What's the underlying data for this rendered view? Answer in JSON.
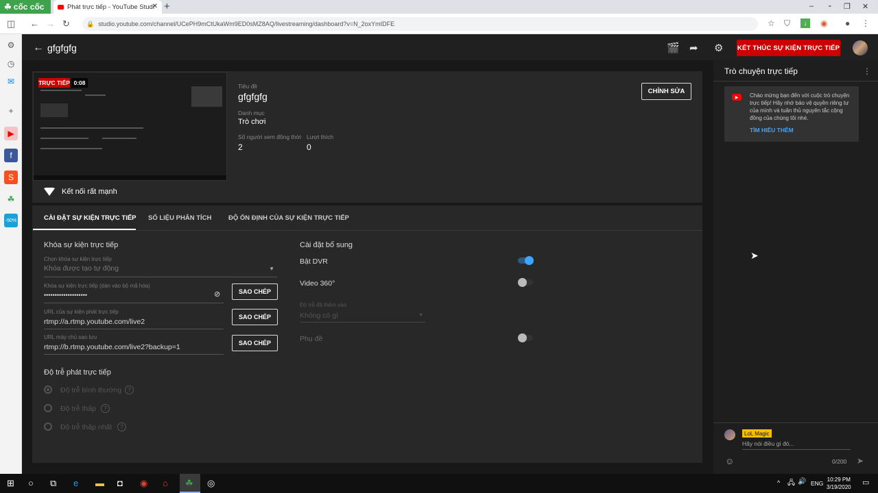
{
  "browser": {
    "brand": "cốc cốc",
    "tab_title": "Phát trực tiếp - YouTube Studi",
    "url": "studio.youtube.com/channel/UCePH9mCtUkaWm9ED0sMZ8AQ/livestreaming/dashboard?v=N_2oxYmIDFE"
  },
  "header": {
    "title": "gfgfgfg",
    "end_button": "KẾT THÚC SỰ KIỆN TRỰC TIẾP"
  },
  "preview": {
    "live_label": "TRỰC TIẾP",
    "elapsed": "0:08"
  },
  "stream_info": {
    "title_label": "Tiêu đề",
    "title_value": "gfgfgfg",
    "category_label": "Danh mục",
    "category_value": "Trò chơi",
    "viewers_label": "Số người xem đồng thời",
    "viewers_value": "2",
    "likes_label": "Lượt thích",
    "likes_value": "0",
    "edit_button": "CHỈNH SỬA",
    "connection": "Kết nối rất mạnh"
  },
  "tabs": [
    "CÀI ĐẶT SỰ KIỆN TRỰC TIẾP",
    "SỐ LIỆU PHÂN TÍCH",
    "ĐỘ ỔN ĐỊNH CỦA SỰ KIỆN TRỰC TIẾP"
  ],
  "stream_key": {
    "section": "Khóa sự kiện trực tiếp",
    "select_label": "Chọn khóa sự kiện trực tiếp",
    "select_value": "Khóa được tạo tự động",
    "key_label": "Khóa sự kiện trực tiếp (dán vào bộ mã hóa)",
    "key_value": "••••••••••••••••••••",
    "url_label": "URL của sự kiện phát trực tiếp",
    "url_value": "rtmp://a.rtmp.youtube.com/live2",
    "backup_label": "URL máy chủ sao lưu",
    "backup_value": "rtmp://b.rtmp.youtube.com/live2?backup=1",
    "copy": "SAO CHÉP"
  },
  "latency": {
    "section": "Độ trễ phát trực tiếp",
    "options": [
      "Độ trễ bình thường",
      "Độ trễ thấp",
      "Độ trễ thấp nhất"
    ]
  },
  "additional": {
    "section": "Cài đặt bổ sung",
    "dvr": "Bật DVR",
    "video360": "Video 360°",
    "delay_label": "Độ trễ đã thêm vào",
    "delay_value": "Không có gì",
    "captions": "Phụ đề"
  },
  "chat": {
    "title": "Trò chuyện trực tiếp",
    "welcome": "Chào mừng bạn đến với cuộc trò chuyện trực tiếp! Hãy nhớ bảo vệ quyền riêng tư của mình và tuân thủ nguyên tắc cộng đồng của chúng tôi nhé.",
    "learn_more": "TÌM HIỂU THÊM",
    "user": "LoL Magic",
    "placeholder": "Hãy nói điều gì đó...",
    "count": "0/200"
  },
  "taskbar": {
    "lang": "ENG",
    "time": "10:29 PM",
    "date": "3/19/2020"
  },
  "colors": {
    "end_button": "#cc0000",
    "toggle_on": "#3ea6ff",
    "chat_name_badge": "#f6c000",
    "brand": "#3fa34d"
  }
}
